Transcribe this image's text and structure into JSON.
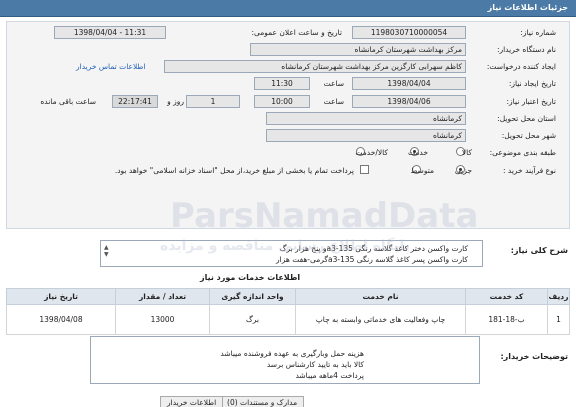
{
  "header": {
    "title": "جزئیات اطلاعات نیاز"
  },
  "form": {
    "need_number_label": "شماره نیاز:",
    "need_number": "1198030710000054",
    "announce_label": "تاریخ و ساعت اعلان عمومی:",
    "announce_value": "1398/04/04 - 11:31",
    "buyer_org_label": "نام دستگاه خریدار:",
    "buyer_org": "مرکز بهداشت شهرستان کرمانشاه",
    "creator_label": "ایجاد کننده درخواست:",
    "creator": "کاظم  سهرابی کارگزین مرکز بهداشت شهرستان کرمانشاه",
    "contact_link": "اطلاعات تماس خریدار",
    "need_date_label": "تاریخ ایجاد نیاز:",
    "need_date": "1398/04/04",
    "time_label": "ساعت",
    "need_time": "11:30",
    "validity_label": "تاریخ اعتبار نیاز:",
    "validity_date": "1398/04/06",
    "validity_time": "10:00",
    "days_value": "1",
    "days_label": "روز و",
    "remaining_time": "22:17:41",
    "remaining_label": "ساعت باقی مانده",
    "province_label": "استان محل تحویل:",
    "province": "کرمانشاه",
    "city_label": "شهر محل تحویل:",
    "city": "کرمانشاه",
    "category_label": "طبقه بندی موضوعی:",
    "category_options": [
      "کالا",
      "خدمت",
      "کالا/خدمت"
    ],
    "category_selected": "خدمت",
    "purchase_label": "نوع فرآیند خرید :",
    "purchase_options": [
      "جزیی",
      "متوسط"
    ],
    "purchase_selected": "جزیی",
    "payment_note": "پرداخت تمام یا بخشی از مبلغ خرید،از محل \"اسناد خزانه اسلامی\" خواهد بود."
  },
  "description": {
    "label": "شرح کلی نیاز:",
    "lines": [
      "کارت واکسن دختر کاغذ گلاسه  رنگی 135-a3و پنج هزار برگ",
      "کارت واکسن پسر کاغذ گلاسه  رنگی a3-135گرمی-هفت هزار"
    ]
  },
  "items": {
    "title": "اطلاعات خدمات مورد نیاز",
    "columns": [
      "ردیف",
      "کد خدمت",
      "نام خدمت",
      "واحد اندازه گیری",
      "تعداد / مقدار",
      "تاریخ نیاز"
    ],
    "rows": [
      [
        "1",
        "ب-18-181",
        "چاپ وفعالیت های خدماتی وابسته به چاپ",
        "برگ",
        "13000",
        "1398/04/08"
      ]
    ]
  },
  "notes": {
    "label": "توضیحات خریدار:",
    "lines": [
      "هزینه حمل وبارگیری به عهده فروشنده میباشد",
      "کالا باید به تایید کارشناس برسد",
      "پرداخت 4ماهه میباشد"
    ]
  },
  "bottom": {
    "attachments": "مدارک و مستندات (0)",
    "buyer_info": "اطلاعات خریدار"
  },
  "watermark": {
    "line1": "ParsNamadData",
    "line2": "پایگاه اطلاع رسانی مناقصه و مزایده"
  }
}
